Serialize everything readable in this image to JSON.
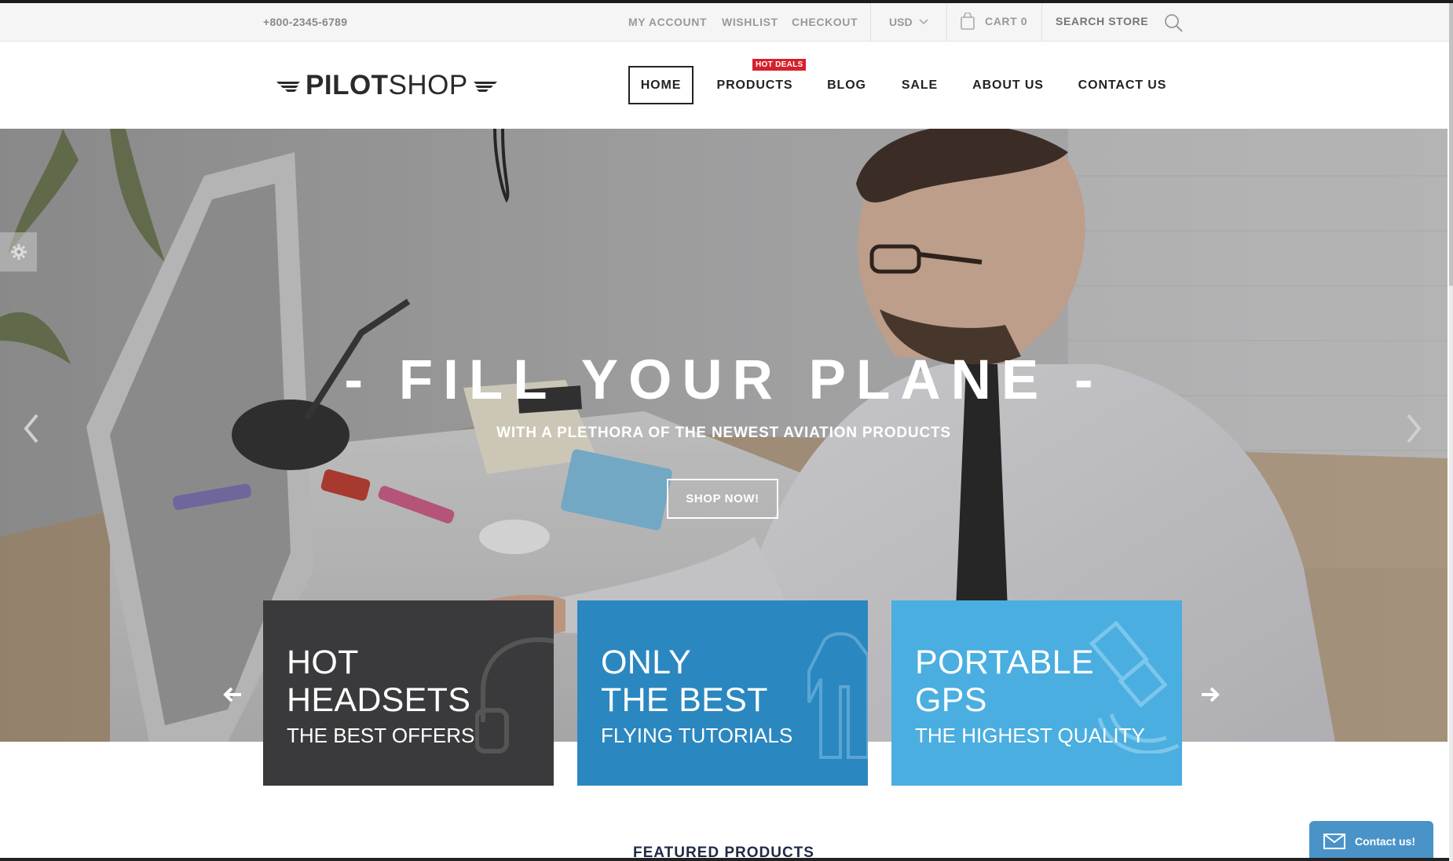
{
  "topbar": {
    "phone": "+800-2345-6789",
    "my_account": "MY ACCOUNT",
    "wishlist": "WISHLIST",
    "checkout": "CHECKOUT",
    "currency": "USD",
    "cart": "CART 0",
    "search_placeholder": "SEARCH STORE"
  },
  "logo": {
    "bold": "PILOT",
    "light": "SHOP"
  },
  "nav": {
    "home": "HOME",
    "products": "PRODUCTS",
    "products_badge": "HOT DEALS",
    "blog": "BLOG",
    "sale": "SALE",
    "about": "ABOUT US",
    "contact": "CONTACT US"
  },
  "hero": {
    "title": "- FILL YOUR PLANE -",
    "subtitle": "WITH A PLETHORA OF THE NEWEST AVIATION PRODUCTS",
    "button": "SHOP NOW!"
  },
  "promos": [
    {
      "line1": "HOT",
      "line2": "HEADSETS",
      "line3": "THE BEST OFFERS",
      "color": "#3a3a3c",
      "icon": "headset-icon"
    },
    {
      "line1": "ONLY",
      "line2": "THE BEST",
      "line3": "FLYING TUTORIALS",
      "color": "#2b87c0",
      "icon": "jacket-icon"
    },
    {
      "line1": "PORTABLE",
      "line2": "GPS",
      "line3": "THE HIGHEST QUALITY",
      "color": "#4aaee0",
      "icon": "satellite-icon"
    }
  ],
  "featured_heading": "FEATURED PRODUCTS",
  "contact_widget": "Contact us!",
  "colors": {
    "accent_blue": "#2b87c0",
    "light_blue": "#4aaee0",
    "dark_tile": "#3a3a3c",
    "badge_red": "#d6202b"
  }
}
